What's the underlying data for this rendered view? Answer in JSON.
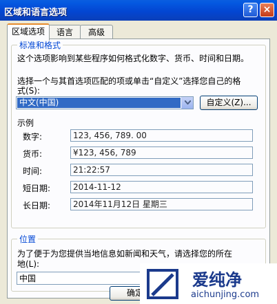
{
  "window": {
    "title": "区域和语言选项",
    "help_label": "?",
    "close_label": "×"
  },
  "tabs": [
    {
      "label": "区域选项",
      "active": true
    },
    {
      "label": "语言",
      "active": false
    },
    {
      "label": "高级",
      "active": false
    }
  ],
  "standards": {
    "group_title": "标准和格式",
    "description": "这个选项影响到某些程序如何格式化数字、货币、时间和日期。",
    "instruction_line1": "选择一个与其首选项匹配的项或单击“自定义”选择您自己的格",
    "instruction_line2": "式(S):",
    "selected_locale": "中文(中国)",
    "customize_button": "自定义(Z)...",
    "samples_title": "示例",
    "samples": [
      {
        "label": "数字:",
        "value": "123, 456, 789. 00"
      },
      {
        "label": "货币:",
        "value": "¥123, 456, 789"
      },
      {
        "label": "时间:",
        "value": "21:22:57"
      },
      {
        "label": "短日期:",
        "value": "2014-11-12"
      },
      {
        "label": "长日期:",
        "value": "2014年11月12日 星期三"
      }
    ]
  },
  "location": {
    "group_title": "位置",
    "instruction_line1": "为了便于为您提供当地信息如新闻和天气，请选择您的所在",
    "instruction_line2": "地(L):",
    "selected_location": "中国"
  },
  "footer": {
    "ok_button": "确定"
  },
  "watermark": {
    "text": "爱纯净",
    "url": "aichunjing.com"
  }
}
